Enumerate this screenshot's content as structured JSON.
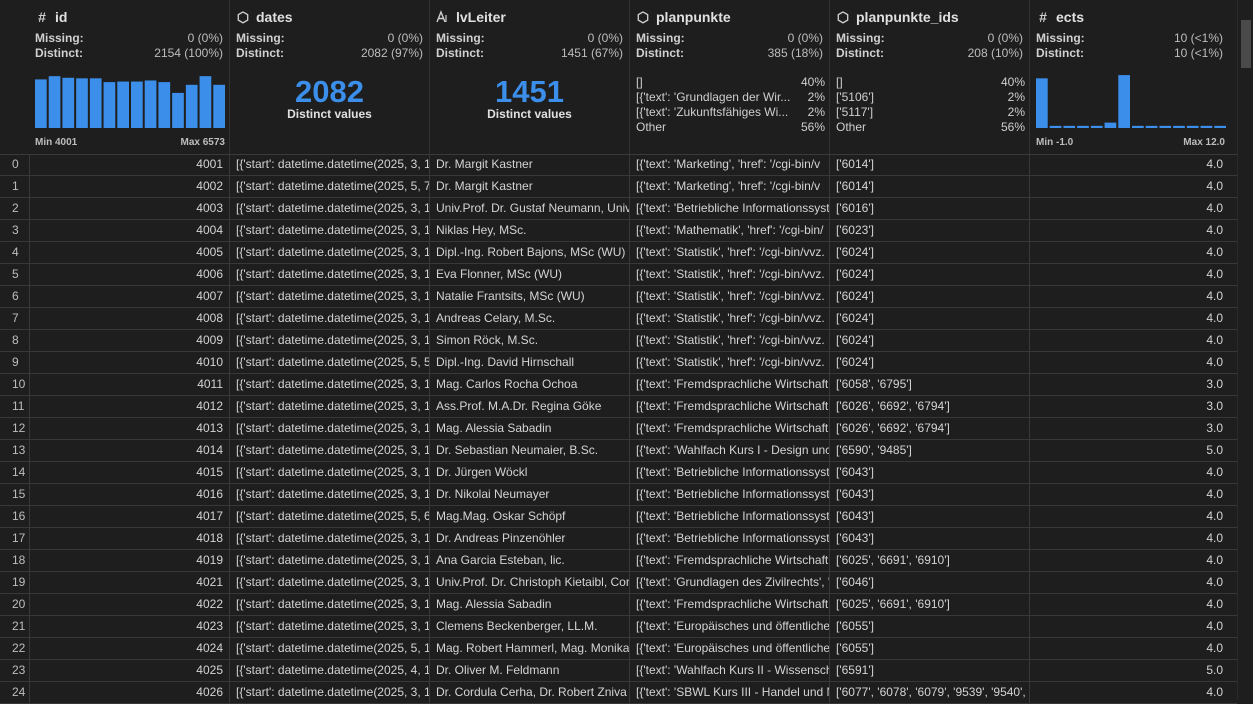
{
  "columns": {
    "id": {
      "name": "id",
      "icon": "hash-icon",
      "glyph": "#",
      "missing_label": "Missing:",
      "missing": "0 (0%)",
      "distinct_label": "Distinct:",
      "distinct": "2154 (100%)",
      "hist_min": "Min 4001",
      "hist_max": "Max 6573",
      "hist": [
        0.9,
        0.96,
        0.93,
        0.92,
        0.92,
        0.85,
        0.86,
        0.86,
        0.88,
        0.85,
        0.65,
        0.8,
        0.96,
        0.8
      ]
    },
    "dates": {
      "name": "dates",
      "icon": "cube-icon",
      "glyph": "⬡",
      "missing_label": "Missing:",
      "missing": "0 (0%)",
      "distinct_label": "Distinct:",
      "distinct": "2082 (97%)",
      "big": "2082",
      "big_label": "Distinct values"
    },
    "lvLeiter": {
      "name": "lvLeiter",
      "icon": "text-icon",
      "glyph": "A",
      "missing_label": "Missing:",
      "missing": "0 (0%)",
      "distinct_label": "Distinct:",
      "distinct": "1451 (67%)",
      "big": "1451",
      "big_label": "Distinct values"
    },
    "planpunkte": {
      "name": "planpunkte",
      "icon": "cube-icon",
      "glyph": "⬡",
      "missing_label": "Missing:",
      "missing": "0 (0%)",
      "distinct_label": "Distinct:",
      "distinct": "385 (18%)",
      "freq": [
        {
          "t": "[]",
          "p": "40%"
        },
        {
          "t": "[{'text': 'Grundlagen der Wir...",
          "p": "2%"
        },
        {
          "t": "[{'text': 'Zukunftsfähiges Wi...",
          "p": "2%"
        },
        {
          "t": "Other",
          "p": "56%"
        }
      ]
    },
    "planpunkte_ids": {
      "name": "planpunkte_ids",
      "icon": "cube-icon",
      "glyph": "⬡",
      "missing_label": "Missing:",
      "missing": "0 (0%)",
      "distinct_label": "Distinct:",
      "distinct": "208 (10%)",
      "freq": [
        {
          "t": "[]",
          "p": "40%"
        },
        {
          "t": "['5106']",
          "p": "2%"
        },
        {
          "t": "['5117']",
          "p": "2%"
        },
        {
          "t": "Other",
          "p": "56%"
        }
      ]
    },
    "ects": {
      "name": "ects",
      "icon": "hash-icon",
      "glyph": "#",
      "missing_label": "Missing:",
      "missing": "10 (<1%)",
      "distinct_label": "Distinct:",
      "distinct": "10 (<1%)",
      "hist_min": "Min -1.0",
      "hist_max": "Max 12.0",
      "hist": [
        0.92,
        0.04,
        0.04,
        0.04,
        0.04,
        0.1,
        0.98,
        0.04,
        0.04,
        0.04,
        0.04,
        0.04,
        0.04,
        0.04
      ]
    }
  },
  "accent": "#3b8eea",
  "rows": [
    [
      "0",
      "4001",
      "[{'start': datetime.datetime(2025, 3, 1",
      "Dr. Margit Kastner",
      "[{'text': 'Marketing', 'href': '/cgi-bin/v",
      "['6014']",
      "4.0"
    ],
    [
      "1",
      "4002",
      "[{'start': datetime.datetime(2025, 5, 7",
      "Dr. Margit Kastner",
      "[{'text': 'Marketing', 'href': '/cgi-bin/v",
      "['6014']",
      "4.0"
    ],
    [
      "2",
      "4003",
      "[{'start': datetime.datetime(2025, 3, 1",
      "Univ.Prof. Dr. Gustaf Neumann, Univ",
      "[{'text': 'Betriebliche Informationssyst",
      "['6016']",
      "4.0"
    ],
    [
      "3",
      "4004",
      "[{'start': datetime.datetime(2025, 3, 1",
      "Niklas Hey, MSc.",
      "[{'text': 'Mathematik', 'href': '/cgi-bin/",
      "['6023']",
      "4.0"
    ],
    [
      "4",
      "4005",
      "[{'start': datetime.datetime(2025, 3, 1",
      "Dipl.-Ing. Robert Bajons, MSc (WU)",
      "[{'text': 'Statistik', 'href': '/cgi-bin/vvz.",
      "['6024']",
      "4.0"
    ],
    [
      "5",
      "4006",
      "[{'start': datetime.datetime(2025, 3, 1",
      "Eva Flonner, MSc (WU)",
      "[{'text': 'Statistik', 'href': '/cgi-bin/vvz.",
      "['6024']",
      "4.0"
    ],
    [
      "6",
      "4007",
      "[{'start': datetime.datetime(2025, 3, 1",
      "Natalie Frantsits, MSc (WU)",
      "[{'text': 'Statistik', 'href': '/cgi-bin/vvz.",
      "['6024']",
      "4.0"
    ],
    [
      "7",
      "4008",
      "[{'start': datetime.datetime(2025, 3, 1",
      "Andreas Celary, M.Sc.",
      "[{'text': 'Statistik', 'href': '/cgi-bin/vvz.",
      "['6024']",
      "4.0"
    ],
    [
      "8",
      "4009",
      "[{'start': datetime.datetime(2025, 3, 1",
      "Simon Röck, M.Sc.",
      "[{'text': 'Statistik', 'href': '/cgi-bin/vvz.",
      "['6024']",
      "4.0"
    ],
    [
      "9",
      "4010",
      "[{'start': datetime.datetime(2025, 5, 5",
      "Dipl.-Ing. David Hirnschall",
      "[{'text': 'Statistik', 'href': '/cgi-bin/vvz.",
      "['6024']",
      "4.0"
    ],
    [
      "10",
      "4011",
      "[{'start': datetime.datetime(2025, 3, 1",
      "Mag. Carlos Rocha Ochoa",
      "[{'text': 'Fremdsprachliche Wirtschaft",
      "['6058', '6795']",
      "3.0"
    ],
    [
      "11",
      "4012",
      "[{'start': datetime.datetime(2025, 3, 1",
      "Ass.Prof. M.A.Dr. Regina Göke",
      "[{'text': 'Fremdsprachliche Wirtschaft",
      "['6026', '6692', '6794']",
      "3.0"
    ],
    [
      "12",
      "4013",
      "[{'start': datetime.datetime(2025, 3, 1",
      "Mag. Alessia Sabadin",
      "[{'text': 'Fremdsprachliche Wirtschaft",
      "['6026', '6692', '6794']",
      "3.0"
    ],
    [
      "13",
      "4014",
      "[{'start': datetime.datetime(2025, 3, 1",
      "Dr. Sebastian Neumaier, B.Sc.",
      "[{'text': 'Wahlfach Kurs I - Design unc",
      "['6590', '9485']",
      "5.0"
    ],
    [
      "14",
      "4015",
      "[{'start': datetime.datetime(2025, 3, 1",
      "Dr. Jürgen Wöckl",
      "[{'text': 'Betriebliche Informationssyst",
      "['6043']",
      "4.0"
    ],
    [
      "15",
      "4016",
      "[{'start': datetime.datetime(2025, 3, 1",
      "Dr. Nikolai Neumayer",
      "[{'text': 'Betriebliche Informationssyst",
      "['6043']",
      "4.0"
    ],
    [
      "16",
      "4017",
      "[{'start': datetime.datetime(2025, 5, 6",
      "Mag.Mag. Oskar Schöpf",
      "[{'text': 'Betriebliche Informationssyst",
      "['6043']",
      "4.0"
    ],
    [
      "17",
      "4018",
      "[{'start': datetime.datetime(2025, 3, 1",
      "Dr. Andreas Pinzenöhler",
      "[{'text': 'Betriebliche Informationssyst",
      "['6043']",
      "4.0"
    ],
    [
      "18",
      "4019",
      "[{'start': datetime.datetime(2025, 3, 1",
      "Ana Garcia Esteban, lic.",
      "[{'text': 'Fremdsprachliche Wirtschaft",
      "['6025', '6691', '6910']",
      "4.0"
    ],
    [
      "19",
      "4021",
      "[{'start': datetime.datetime(2025, 3, 1",
      "Univ.Prof. Dr. Christoph Kietaibl, Cor",
      "[{'text': 'Grundlagen des Zivilrechts', '",
      "['6046']",
      "4.0"
    ],
    [
      "20",
      "4022",
      "[{'start': datetime.datetime(2025, 3, 1",
      "Mag. Alessia Sabadin",
      "[{'text': 'Fremdsprachliche Wirtschaft",
      "['6025', '6691', '6910']",
      "4.0"
    ],
    [
      "21",
      "4023",
      "[{'start': datetime.datetime(2025, 3, 1",
      "Clemens Beckenberger, LL.M.",
      "[{'text': 'Europäisches und öffentliche",
      "['6055']",
      "4.0"
    ],
    [
      "22",
      "4024",
      "[{'start': datetime.datetime(2025, 5, 1",
      "Mag. Robert Hammerl, Mag. Monika",
      "[{'text': 'Europäisches und öffentliche",
      "['6055']",
      "4.0"
    ],
    [
      "23",
      "4025",
      "[{'start': datetime.datetime(2025, 4, 1",
      "Dr. Oliver M. Feldmann",
      "[{'text': 'Wahlfach Kurs II - Wissensch",
      "['6591']",
      "5.0"
    ],
    [
      "24",
      "4026",
      "[{'start': datetime.datetime(2025, 3, 1",
      "Dr. Cordula Cerha, Dr. Robert Zniva",
      "[{'text': 'SBWL Kurs III - Handel und M",
      "['6077', '6078', '6079', '9539', '9540', '",
      "4.0"
    ]
  ]
}
